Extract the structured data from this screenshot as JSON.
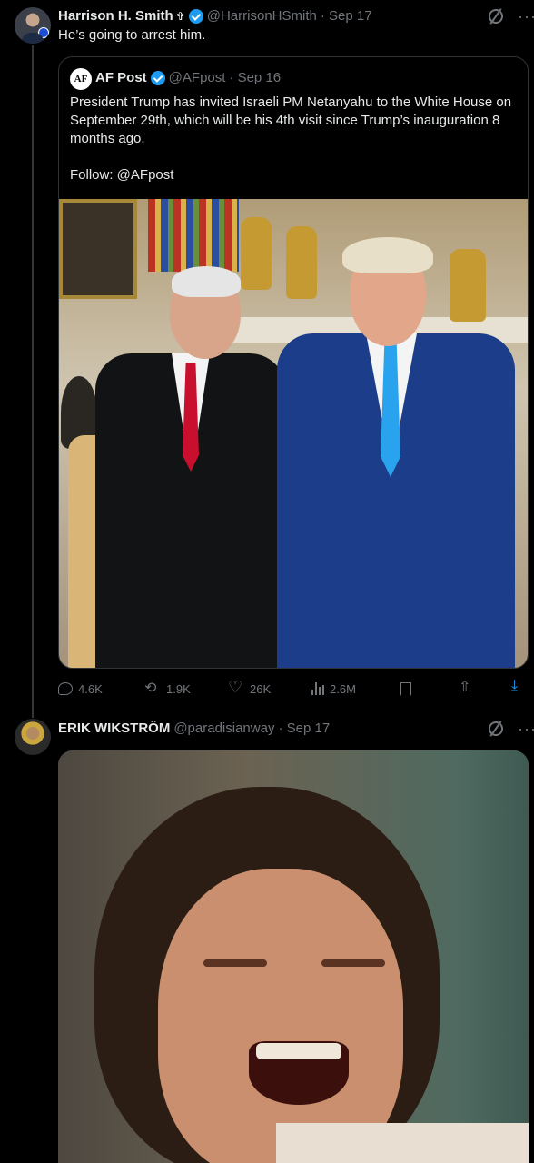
{
  "tweet1": {
    "name": "Harrison H. Smith",
    "badge_symbol": "✞",
    "handle": "@HarrisonHSmith",
    "date": "· Sep 17",
    "text": "He’s going to arrest him."
  },
  "quote": {
    "avatar_text": "AF",
    "name": "AF Post",
    "handle": "@AFpost",
    "date": "· Sep 16",
    "text_p1": "President Trump has invited Israeli PM Netanyahu to the White House on September 29th, which will be his 4th visit since Trump’s inauguration 8 months ago.",
    "text_p2": "Follow: @AFpost"
  },
  "actions": {
    "replies": "4.6K",
    "reposts": "1.9K",
    "likes": "26K",
    "views": "2.6M"
  },
  "tweet2": {
    "name": "ERIK WIKSTRÖM",
    "handle": "@paradisianway",
    "date": "· Sep 17"
  },
  "icons": {
    "grok": "grok-icon",
    "more": "more-icon",
    "reply": "reply-icon",
    "repost": "repost-icon",
    "like": "like-icon",
    "views": "views-icon",
    "bookmark": "bookmark-icon",
    "share": "share-icon",
    "download": "download-icon"
  },
  "colors": {
    "background": "#000000",
    "text": "#e7e9ea",
    "muted": "#71767b",
    "verified": "#1d9bf0",
    "border": "#2f3336"
  }
}
